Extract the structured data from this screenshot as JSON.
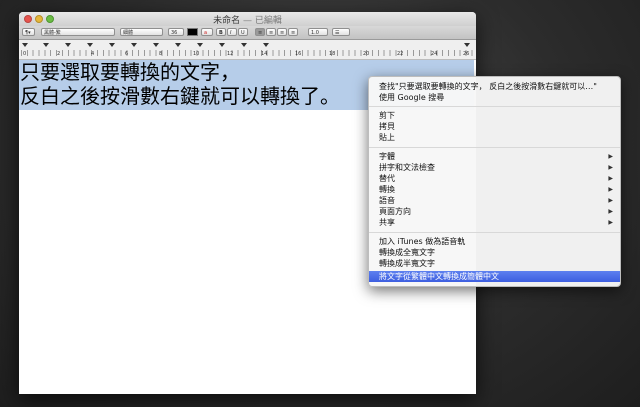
{
  "window": {
    "title": "未命名",
    "title_separator": "—",
    "title_status": "已編輯"
  },
  "toolbar": {
    "style_popup": "¶▾",
    "font_family": "黑體-繁",
    "font_style": "細體",
    "font_size": "36",
    "bold": "B",
    "italic": "I",
    "underline": "U",
    "align_left": "≡",
    "align_center": "≡",
    "align_right": "≡",
    "align_justify": "≡",
    "line_spacing": "1.0",
    "list": "☰"
  },
  "ruler": {
    "numbers": [
      "0",
      "2",
      "4",
      "6",
      "8",
      "10",
      "12",
      "14",
      "16",
      "18",
      "20",
      "22",
      "24",
      "26"
    ]
  },
  "document": {
    "line1": "只要選取要轉換的文字，",
    "line2": "反白之後按滑數右鍵就可以轉換了。"
  },
  "context_menu": {
    "lookup": "查找\"只要選取要轉換的文字，  反白之後按滑數右鍵就可以…\"",
    "google": "使用 Google 搜尋",
    "cut": "剪下",
    "copy": "拷貝",
    "paste": "貼上",
    "font": "字體",
    "spelling": "拼字和文法檢查",
    "substitutions": "替代",
    "transformations": "轉換",
    "speech": "語音",
    "layout_orientation": "頁面方向",
    "share": "共享",
    "add_itunes": "加入 iTunes 做為語音軌",
    "to_fullwidth": "轉換成全寬文字",
    "to_halfwidth": "轉換成半寬文字",
    "trad_to_simp": "將文字從繁體中文轉換成簡體中文"
  },
  "colors": {
    "selection": "#b6cde9",
    "menu_highlight": "#4a6ce6"
  }
}
